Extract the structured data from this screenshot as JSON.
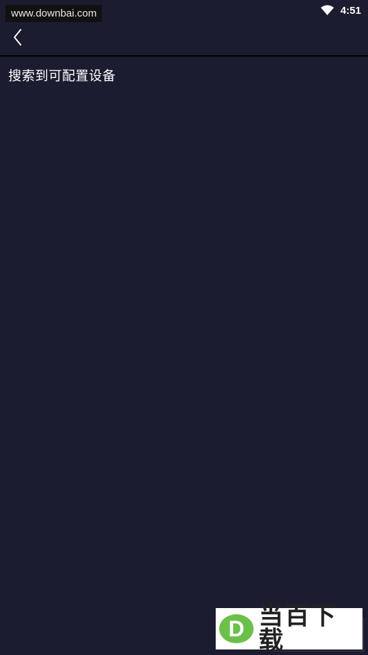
{
  "status_bar": {
    "watermark_url": "www.downbai.com",
    "time": "4:51",
    "icons": [
      "wifi-icon"
    ]
  },
  "app_bar": {
    "back_icon": "chevron-left-icon"
  },
  "content": {
    "section_title": "搜索到可配置设备"
  },
  "logo_watermark": {
    "text": "当百下载",
    "mark_letter": "D",
    "mark_color": "#6cc04a"
  },
  "colors": {
    "background": "#1b1c2f",
    "divider": "#000000",
    "text": "#ffffff"
  }
}
